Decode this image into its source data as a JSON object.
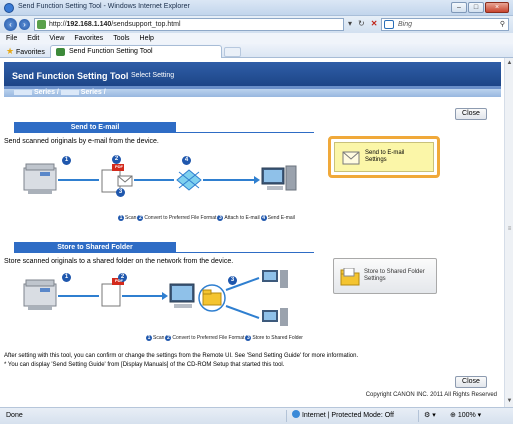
{
  "window": {
    "title": "Send Function Setting Tool - Windows Internet Explorer",
    "buttons": {
      "minimize": "–",
      "maximize": "□",
      "close": "×"
    }
  },
  "address_bar": {
    "url_prefix": "http://",
    "url_host": "192.168.1.140",
    "url_path": "/sendsupport_top.html",
    "search_value": "Bing"
  },
  "menu": [
    "File",
    "Edit",
    "View",
    "Favorites",
    "Tools",
    "Help"
  ],
  "favorites_bar": {
    "favorites_label": "Favorites",
    "tab_label": "Send Function Setting Tool"
  },
  "page": {
    "header_title": "Send Function Setting Tool",
    "header_subtitle": "Select Setting",
    "series_text_1": "Series /",
    "series_text_2": "Series /",
    "close_label": "Close",
    "email_section": {
      "heading": "Send to E-mail",
      "description": "Send scanned originals by e-mail from the device.",
      "steps": [
        "1",
        "2",
        "3",
        "4"
      ],
      "pdf_label": "PDF",
      "legend": [
        "Scan",
        "Convert to Preferred File Format",
        "Attach to E-mail",
        "Send E-mail"
      ],
      "button_line1": "Send to E-mail",
      "button_line2": "Settings"
    },
    "folder_section": {
      "heading": "Store to Shared Folder",
      "description": "Store scanned originals to a shared folder on the network from the device.",
      "steps": [
        "1",
        "2",
        "3"
      ],
      "pdf_label": "PDF",
      "legend": [
        "Scan",
        "Convert to Preferred File Format",
        "Store to Shared Folder"
      ],
      "button_line1": "Store to Shared Folder",
      "button_line2": "Settings"
    },
    "note_1": "After setting with this tool, you can confirm or change the settings from the Remote UI. See 'Send Setting Guide' for more information.",
    "note_2": "* You can display 'Send Setting Guide' from [Display Manuals] of the CD-ROM Setup that started this tool.",
    "copyright": "Copyright CANON INC. 2011 All Rights Reserved"
  },
  "status_bar": {
    "status": "Done",
    "zone": "Internet | Protected Mode: Off",
    "zoom": "100%"
  },
  "colors": {
    "header_blue": "#1d4587",
    "section_blue": "#2e6cc5",
    "email_button_highlight": "#f0a93a",
    "email_button_fill": "#fbf6a8"
  }
}
